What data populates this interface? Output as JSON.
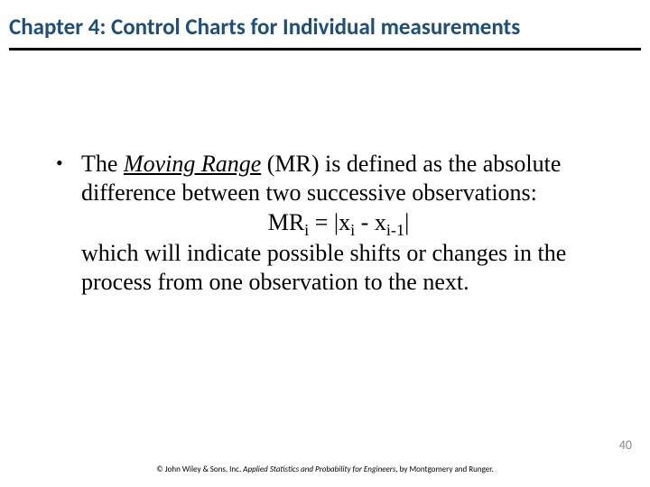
{
  "title": "Chapter 4: Control Charts for Individual measurements",
  "bullet": {
    "marker": "•",
    "lead": "The ",
    "term": "Moving Range",
    "after_term": " (MR) is defined as the absolute difference between two successive observations:",
    "formula_mr": "MR",
    "formula_sub_i": "i",
    "formula_eq": " = |x",
    "formula_sub_i2": "i",
    "formula_minus": " - x",
    "formula_sub_im1": "i-1",
    "formula_close": "|",
    "tail": " which will indicate possible shifts or changes in the process from one observation to the next."
  },
  "page_number": "40",
  "footer": {
    "copyright": "© John Wiley & Sons, Inc.  ",
    "book": "Applied Statistics and Probability for Engineers",
    "authors": ", by Montgomery and Runger."
  }
}
